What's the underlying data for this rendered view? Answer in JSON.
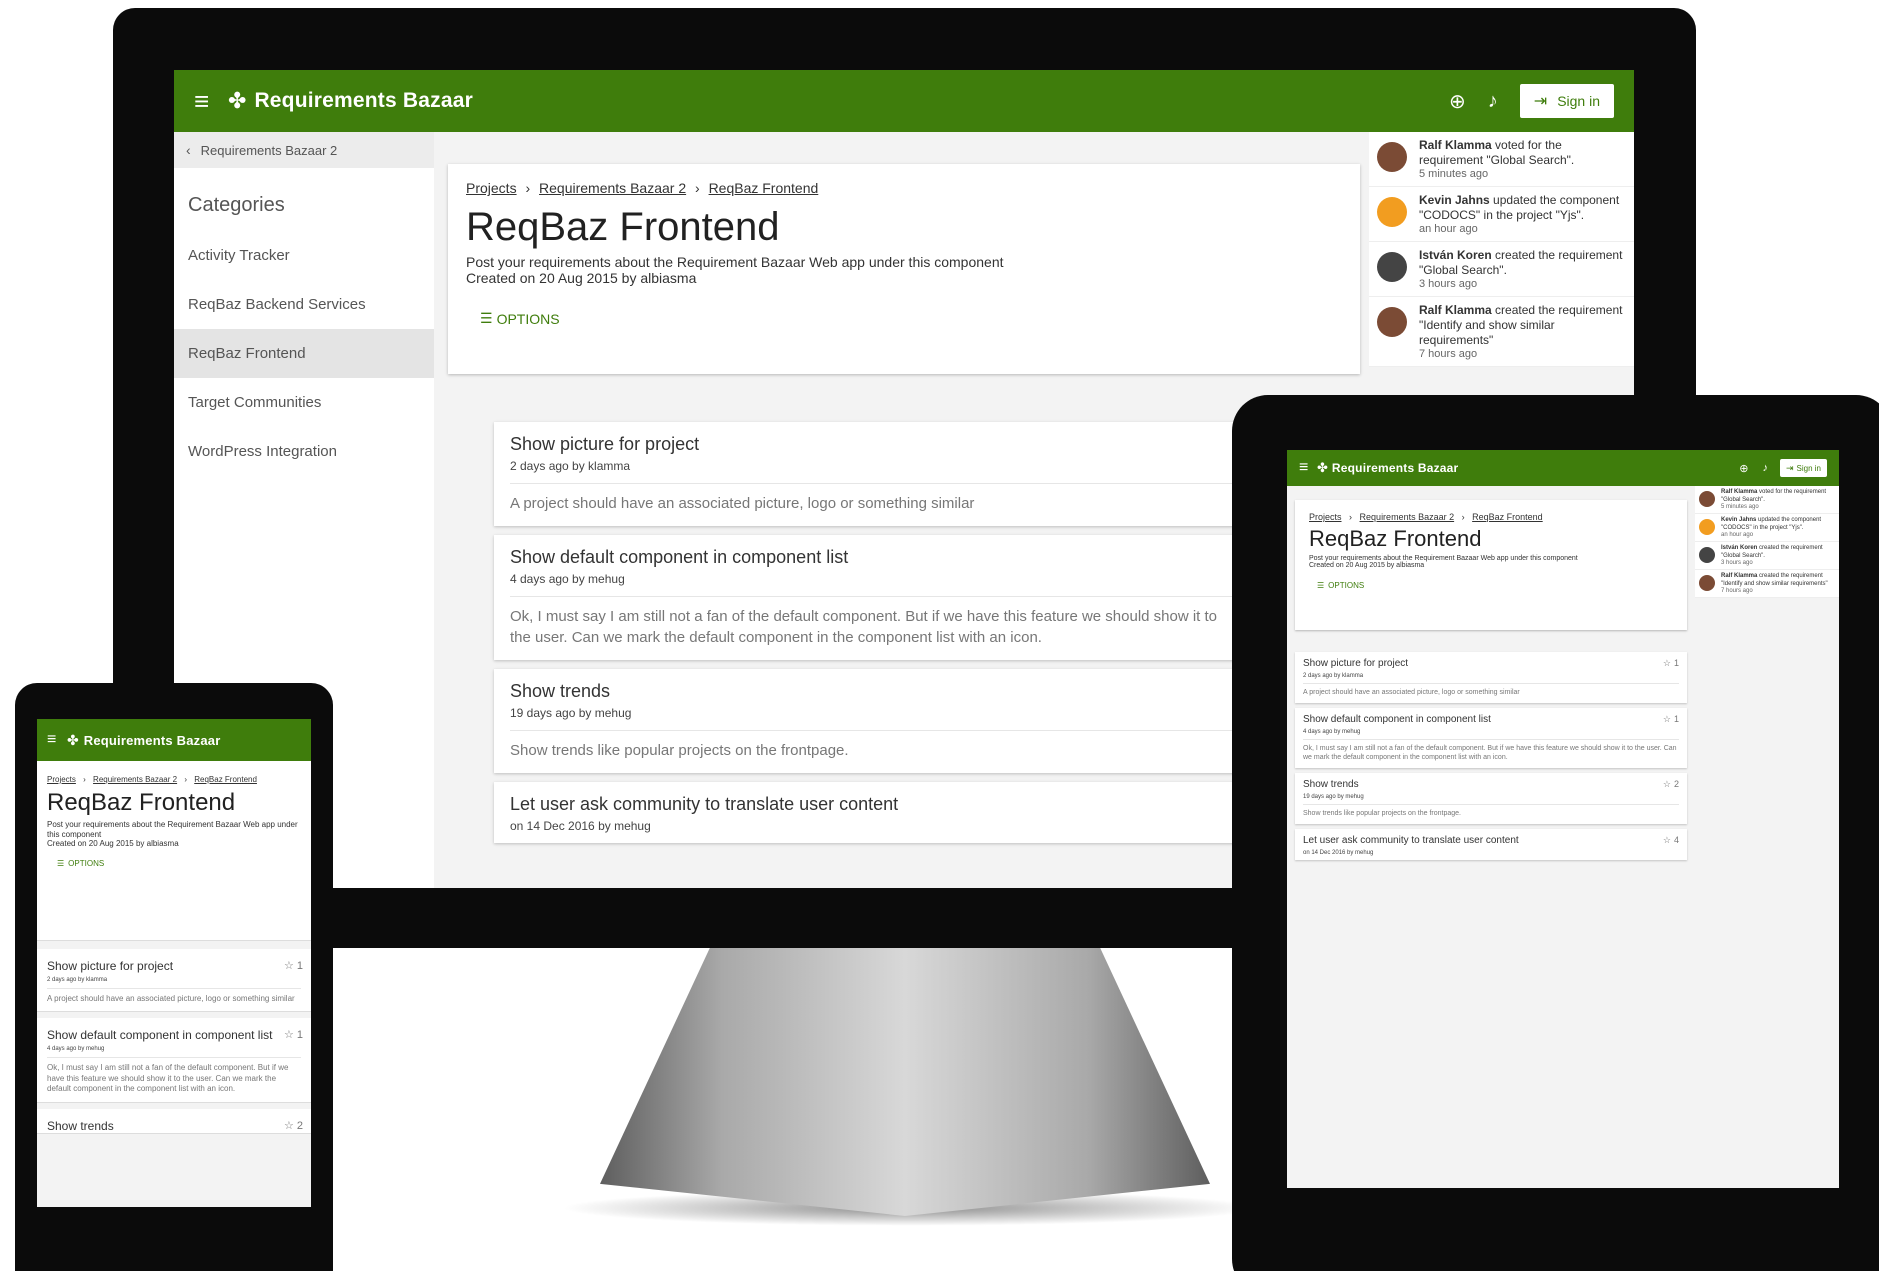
{
  "app": {
    "brand": "Requirements Bazaar",
    "sign_in_label": "Sign in",
    "accent": "#3f7d0c"
  },
  "sidebar": {
    "back_label": "Requirements Bazaar 2",
    "title": "Categories",
    "items": [
      {
        "label": "Activity Tracker"
      },
      {
        "label": "ReqBaz Backend Services"
      },
      {
        "label": "ReqBaz Frontend"
      },
      {
        "label": "Target Communities"
      },
      {
        "label": "WordPress Integration"
      }
    ]
  },
  "header": {
    "breadcrumb": [
      "Projects",
      "Requirements Bazaar 2",
      "ReqBaz Frontend"
    ],
    "breadcrumb_sep": "›",
    "title": "ReqBaz Frontend",
    "description": "Post your requirements about the Requirement Bazaar Web app under this component",
    "meta": "Created on 20 Aug 2015 by albiasma",
    "options_label": "OPTIONS"
  },
  "requirements": [
    {
      "title": "Show picture for project",
      "meta": "2 days ago by klamma",
      "body": "A project should have an associated picture, logo or something similar",
      "votes": "1"
    },
    {
      "title": "Show default component in component list",
      "meta": "4 days ago by mehug",
      "body": "Ok, I must say I am still not a fan of the default component. But if we have this feature we should show it to the user. Can we mark the default component in the component list with an icon.",
      "votes": "1"
    },
    {
      "title": "Show trends",
      "meta": "19 days ago by mehug",
      "body": "Show trends like popular projects on the frontpage.",
      "votes": "2"
    },
    {
      "title": "Let user ask community to translate user content",
      "meta": "on 14 Dec 2016 by mehug",
      "body": "",
      "votes": "4"
    }
  ],
  "activity": [
    {
      "who": "Ralf Klamma",
      "text": "voted for the requirement \"Global Search\".",
      "time": "5 minutes ago"
    },
    {
      "who": "Kevin Jahns",
      "text": "updated the component \"CODOCS\" in the project \"Yjs\".",
      "time": "an hour ago"
    },
    {
      "who": "István Koren",
      "text": "created the requirement \"Global Search\".",
      "time": "3 hours ago"
    },
    {
      "who": "Ralf Klamma",
      "text": "created the requirement \"Identify and show similar requirements\"",
      "time": "7 hours ago"
    }
  ]
}
